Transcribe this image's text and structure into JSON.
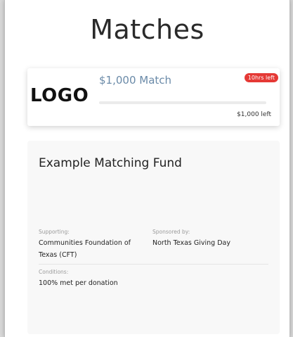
{
  "page": {
    "title": "Matches"
  },
  "match_card": {
    "logo_text": "LOGO",
    "amount": "$1,000 Match",
    "time_left": "10hrs left",
    "progress": 0,
    "amount_left": "$1,000 left",
    "accent_color": "#6a8aa8",
    "badge_color": "#e53935"
  },
  "fund": {
    "title": "Example Matching Fund",
    "supporting_label": "Supporting:",
    "supporting_value": "Communities Foundation of Texas (CFT)",
    "sponsored_label": "Sponsored by:",
    "sponsored_value": "North Texas Giving Day",
    "conditions_label": "Conditions:",
    "conditions_value": "100% met per donation"
  }
}
